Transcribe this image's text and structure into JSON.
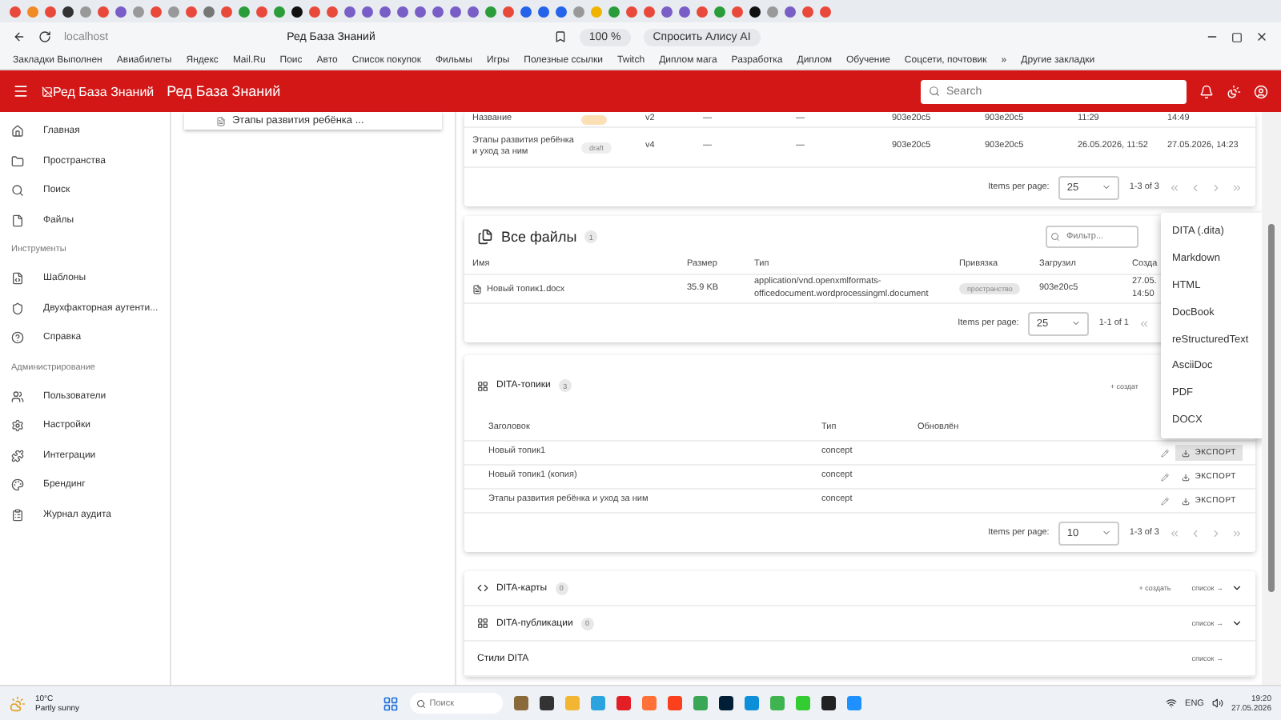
{
  "browser": {
    "address": "localhost",
    "page_title": "Ред База Знаний",
    "zoom": "100 %",
    "assistant": "Спросить Алису AI",
    "bookmarks": [
      "Закладки Выполнен",
      "Авиабилеты",
      "Яндекс",
      "Mail.Ru",
      "Поис",
      "Авто",
      "Список покупок",
      "Фильмы",
      "Игры",
      "Полезные ссылки",
      "Twitch",
      "Диплом мага",
      "Разработка",
      "Диплом",
      "Обучение",
      "Соцсети, почтовик",
      "»",
      "Другие закладки"
    ]
  },
  "app": {
    "logo_alt": "Ред База Знаний",
    "title": "Ред База Знаний",
    "search": {
      "placeholder": "Search"
    }
  },
  "sidebar": {
    "items": [
      {
        "kind": "item",
        "label": "Главная"
      },
      {
        "kind": "item",
        "label": "Пространства"
      },
      {
        "kind": "item",
        "label": "Поиск"
      },
      {
        "kind": "item",
        "label": "Файлы"
      },
      {
        "kind": "heading",
        "label": "Инструменты"
      },
      {
        "kind": "item",
        "label": "Шаблоны"
      },
      {
        "kind": "item",
        "label": "Двухфакторная аутенти..."
      },
      {
        "kind": "item",
        "label": "Справка"
      },
      {
        "kind": "heading",
        "label": "Администрирование"
      },
      {
        "kind": "item",
        "label": "Пользователи"
      },
      {
        "kind": "item",
        "label": "Настройки"
      },
      {
        "kind": "item",
        "label": "Интеграции"
      },
      {
        "kind": "item",
        "label": "Брендинг"
      },
      {
        "kind": "item",
        "label": "Журнал аудита"
      }
    ]
  },
  "recent": {
    "label": "Этапы развития ребёнка ..."
  },
  "versions": {
    "rows": [
      {
        "name": "Название",
        "badge": {
          "color": "#fbe0b5"
        },
        "cells": [
          "v2",
          "—",
          "—",
          "903e20c5",
          "903e20c5",
          "11:29",
          "14:49"
        ]
      },
      {
        "name": "Этапы развития ребёнка и уход за ним",
        "badge": {
          "color": "#eeeeee",
          "text": "draft"
        },
        "cells": [
          "v4",
          "—",
          "—",
          "903e20c5",
          "903e20c5",
          "26.05.2026, 11:52",
          "27.05.2026, 14:23"
        ]
      }
    ],
    "pager": {
      "label": "Items per page:",
      "size": "25",
      "range": "1-3 of 3"
    }
  },
  "files": {
    "title": "Все файлы",
    "count": "1",
    "filter": {
      "placeholder": "Фильтр..."
    },
    "columns": [
      "Имя",
      "Размер",
      "Тип",
      "Привязка",
      "Загрузил",
      "Созда"
    ],
    "rows": [
      {
        "name": "Новый топик1.docx",
        "size": "35.9 KB",
        "type": "application/vnd.openxmlformats-officedocument.wordprocessingml.document",
        "binding": "пространство",
        "uploader": "903e20c5",
        "created": "27.05. 14:50"
      }
    ],
    "pager": {
      "label": "Items per page:",
      "size": "25",
      "range": "1-1 of 1"
    }
  },
  "topics": {
    "title": "DITA-топики",
    "count": "3",
    "create": "+ создат",
    "columns": [
      "Заголовок",
      "Тип",
      "Обновлён"
    ],
    "rows": [
      {
        "title": "Новый топик1",
        "type": "concept",
        "export": "ЭКСПОРТ",
        "active": true
      },
      {
        "title": "Новый топик1 (копия)",
        "type": "concept",
        "export": "ЭКСПОРТ",
        "active": false
      },
      {
        "title": "Этапы развития ребёнка и уход за ним",
        "type": "concept",
        "export": "ЭКСПОРТ",
        "active": false
      }
    ],
    "pager": {
      "label": "Items per page:",
      "size": "10",
      "range": "1-3 of 3"
    }
  },
  "sections": [
    {
      "title": "DITA-карты",
      "count": "0",
      "create": "+ создать",
      "list": "список →",
      "expanded": false
    },
    {
      "title": "DITA-публикации",
      "count": "0",
      "list": "список →",
      "expanded": false
    },
    {
      "title": "Стили DITA",
      "list": "список →"
    }
  ],
  "export_menu": {
    "items": [
      "DITA (.dita)",
      "Markdown",
      "HTML",
      "DocBook",
      "reStructuredText",
      "AsciiDoc",
      "PDF",
      "DOCX"
    ]
  },
  "taskbar": {
    "temperature": "10°C",
    "weather": "Partly sunny",
    "search": {
      "placeholder": "Поиск"
    },
    "language": "ENG",
    "time": "19:20",
    "date": "27.05.2026"
  }
}
